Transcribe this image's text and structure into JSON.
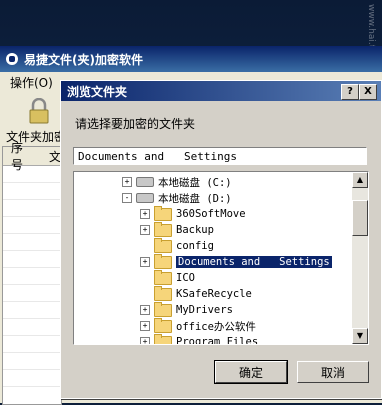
{
  "back_window": {
    "title": "易捷文件(夹)加密软件",
    "menu_label": "操作(O)",
    "tool_label": "文件夹加密",
    "list_headers": [
      "序号",
      "文"
    ]
  },
  "dialog": {
    "title": "浏览文件夹",
    "help_btn": "?",
    "close_btn": "X",
    "prompt": "请选择要加密的文件夹",
    "path_value": "Documents and   Settings",
    "tree": [
      {
        "label": "本地磁盘 (C:)",
        "type": "drive",
        "expander": "+"
      },
      {
        "label": "本地磁盘 (D:)",
        "type": "drive",
        "expander": "-"
      },
      {
        "label": "360SoftMove",
        "type": "folder",
        "expander": "+"
      },
      {
        "label": "Backup",
        "type": "folder",
        "expander": "+"
      },
      {
        "label": "config",
        "type": "folder",
        "expander": ""
      },
      {
        "label": "Documents and   Settings",
        "type": "folder",
        "expander": "+",
        "selected": true
      },
      {
        "label": "ICO",
        "type": "folder",
        "expander": ""
      },
      {
        "label": "KSafeRecycle",
        "type": "folder",
        "expander": ""
      },
      {
        "label": "MyDrivers",
        "type": "folder",
        "expander": "+"
      },
      {
        "label": "office办公软件",
        "type": "folder",
        "expander": "+"
      },
      {
        "label": "Program Files",
        "type": "folder",
        "expander": "+"
      }
    ],
    "ok_label": "确定",
    "cancel_label": "取消"
  },
  "watermark": "www.hai.top"
}
